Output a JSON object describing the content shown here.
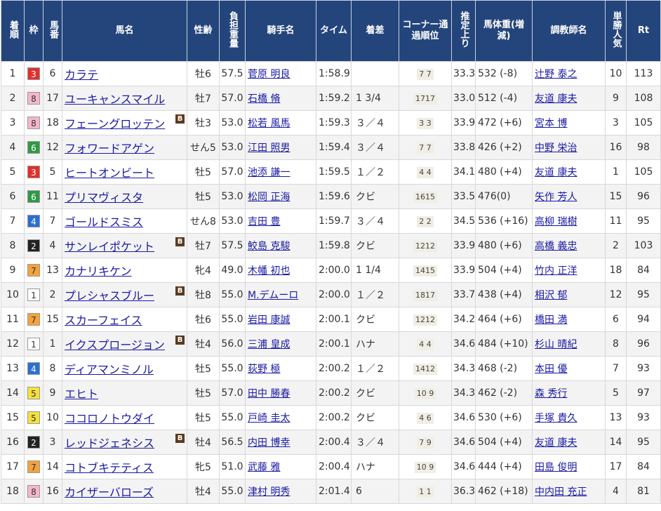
{
  "headers": {
    "rank": "着順",
    "waku": "枠",
    "umaban": "馬番",
    "horse": "馬名",
    "sexage": "性齢",
    "weight": "負担重量",
    "jockey": "騎手名",
    "time": "タイム",
    "margin": "着差",
    "corner": "コーナー通過順位",
    "last3f": "推定上り",
    "body": "馬体重(増減)",
    "trainer": "調教師名",
    "pop": "単勝人気",
    "rt": "Rt"
  },
  "blinker_label": "B",
  "waku_colors": {
    "1": {
      "bg": "#ffffff",
      "fg": "#333333"
    },
    "2": {
      "bg": "#222222",
      "fg": "#ffffff"
    },
    "3": {
      "bg": "#e0302b",
      "fg": "#ffffff"
    },
    "4": {
      "bg": "#2a6fd4",
      "fg": "#ffffff"
    },
    "5": {
      "bg": "#f6e13a",
      "fg": "#333333"
    },
    "6": {
      "bg": "#2f9a45",
      "fg": "#ffffff"
    },
    "7": {
      "bg": "#f4a23a",
      "fg": "#333333"
    },
    "8": {
      "bg": "#f7b6c8",
      "fg": "#333333"
    }
  },
  "rows": [
    {
      "rank": "1",
      "waku": "3",
      "umaban": "6",
      "horse": "カラテ",
      "blinker": false,
      "sexage": "牡6",
      "weight": "57.5",
      "jockey": "菅原 明良",
      "time": "1:58.9",
      "margin": "",
      "corner": "7 7",
      "last3f": "33.3",
      "body": "532 (-8)",
      "trainer": "辻野 泰之",
      "pop": "10",
      "rt": "113"
    },
    {
      "rank": "2",
      "waku": "8",
      "umaban": "17",
      "horse": "ユーキャンスマイル",
      "blinker": false,
      "sexage": "牡7",
      "weight": "57.0",
      "jockey": "石橋 脩",
      "time": "1:59.2",
      "margin": "1 3/4",
      "corner": "1717",
      "last3f": "33.0",
      "body": "512 (-4)",
      "trainer": "友道 康夫",
      "pop": "9",
      "rt": "108"
    },
    {
      "rank": "3",
      "waku": "8",
      "umaban": "18",
      "horse": "フェーングロッテン",
      "blinker": true,
      "sexage": "牡3",
      "weight": "53.0",
      "jockey": "松若 風馬",
      "time": "1:59.3",
      "margin": "３／４",
      "corner": "3 3",
      "last3f": "33.9",
      "body": "472 (+6)",
      "trainer": "宮本 博",
      "pop": "3",
      "rt": "105"
    },
    {
      "rank": "4",
      "waku": "6",
      "umaban": "12",
      "horse": "フォワードアゲン",
      "blinker": false,
      "sexage": "せん5",
      "weight": "53.0",
      "jockey": "江田 照男",
      "time": "1:59.4",
      "margin": "３／４",
      "corner": "7 7",
      "last3f": "33.8",
      "body": "426 (+2)",
      "trainer": "中野 栄治",
      "pop": "16",
      "rt": "98"
    },
    {
      "rank": "5",
      "waku": "3",
      "umaban": "5",
      "horse": "ヒートオンビート",
      "blinker": false,
      "sexage": "牡5",
      "weight": "57.0",
      "jockey": "池添 謙一",
      "time": "1:59.5",
      "margin": "１／２",
      "corner": "4 4",
      "last3f": "34.1",
      "body": "480 (+4)",
      "trainer": "友道 康夫",
      "pop": "1",
      "rt": "105"
    },
    {
      "rank": "6",
      "waku": "6",
      "umaban": "11",
      "horse": "プリマヴィスタ",
      "blinker": false,
      "sexage": "牡5",
      "weight": "53.0",
      "jockey": "松岡 正海",
      "time": "1:59.6",
      "margin": "クビ",
      "corner": "1615",
      "last3f": "33.5",
      "body": "476(0)",
      "trainer": "矢作 芳人",
      "pop": "15",
      "rt": "96"
    },
    {
      "rank": "7",
      "waku": "4",
      "umaban": "7",
      "horse": "ゴールドスミス",
      "blinker": false,
      "sexage": "せん8",
      "weight": "53.0",
      "jockey": "吉田 豊",
      "time": "1:59.7",
      "margin": "３／４",
      "corner": "2 2",
      "last3f": "34.5",
      "body": "536 (+16)",
      "trainer": "高柳 瑞樹",
      "pop": "11",
      "rt": "95"
    },
    {
      "rank": "8",
      "waku": "2",
      "umaban": "4",
      "horse": "サンレイポケット",
      "blinker": true,
      "sexage": "牡7",
      "weight": "57.5",
      "jockey": "鮫島 克駿",
      "time": "1:59.8",
      "margin": "クビ",
      "corner": "1212",
      "last3f": "33.9",
      "body": "480 (+6)",
      "trainer": "高橋 義忠",
      "pop": "2",
      "rt": "103"
    },
    {
      "rank": "9",
      "waku": "7",
      "umaban": "13",
      "horse": "カナリキケン",
      "blinker": false,
      "sexage": "牝4",
      "weight": "49.0",
      "jockey": "木幡 初也",
      "time": "2:00.0",
      "margin": "1 1/4",
      "corner": "1415",
      "last3f": "33.9",
      "body": "504 (+4)",
      "trainer": "竹内 正洋",
      "pop": "18",
      "rt": "84"
    },
    {
      "rank": "10",
      "waku": "1",
      "umaban": "2",
      "horse": "プレシャスブルー",
      "blinker": true,
      "sexage": "牡8",
      "weight": "55.0",
      "jockey": "M.デムーロ",
      "time": "2:00.0",
      "margin": "１／２",
      "corner": "1817",
      "last3f": "33.7",
      "body": "438 (+4)",
      "trainer": "相沢 郁",
      "pop": "12",
      "rt": "95"
    },
    {
      "rank": "11",
      "waku": "7",
      "umaban": "15",
      "horse": "スカーフェイス",
      "blinker": false,
      "sexage": "牡6",
      "weight": "55.0",
      "jockey": "岩田 康誠",
      "time": "2:00.1",
      "margin": "クビ",
      "corner": "1212",
      "last3f": "34.2",
      "body": "464 (+6)",
      "trainer": "橋田 満",
      "pop": "6",
      "rt": "94"
    },
    {
      "rank": "12",
      "waku": "1",
      "umaban": "1",
      "horse": "イクスプロージョン",
      "blinker": true,
      "sexage": "牡4",
      "weight": "56.0",
      "jockey": "三浦 皇成",
      "time": "2:00.1",
      "margin": "ハナ",
      "corner": "4 4",
      "last3f": "34.6",
      "body": "484 (+10)",
      "trainer": "杉山 晴紀",
      "pop": "8",
      "rt": "96"
    },
    {
      "rank": "13",
      "waku": "4",
      "umaban": "8",
      "horse": "ディアマンミノル",
      "blinker": false,
      "sexage": "牡5",
      "weight": "55.0",
      "jockey": "荻野 極",
      "time": "2:00.2",
      "margin": "１／２",
      "corner": "1412",
      "last3f": "34.3",
      "body": "468 (-2)",
      "trainer": "本田 優",
      "pop": "7",
      "rt": "93"
    },
    {
      "rank": "14",
      "waku": "5",
      "umaban": "9",
      "horse": "エヒト",
      "blinker": false,
      "sexage": "牡5",
      "weight": "57.0",
      "jockey": "田中 勝春",
      "time": "2:00.2",
      "margin": "クビ",
      "corner": "10 9",
      "last3f": "34.3",
      "body": "462 (-2)",
      "trainer": "森 秀行",
      "pop": "5",
      "rt": "97"
    },
    {
      "rank": "15",
      "waku": "5",
      "umaban": "10",
      "horse": "ココロノトウダイ",
      "blinker": false,
      "sexage": "牡5",
      "weight": "55.0",
      "jockey": "戸崎 圭太",
      "time": "2:00.2",
      "margin": "クビ",
      "corner": "4 6",
      "last3f": "34.6",
      "body": "530 (+6)",
      "trainer": "手塚 貴久",
      "pop": "13",
      "rt": "93"
    },
    {
      "rank": "16",
      "waku": "2",
      "umaban": "3",
      "horse": "レッドジェネシス",
      "blinker": true,
      "sexage": "牡4",
      "weight": "56.5",
      "jockey": "内田 博幸",
      "time": "2:00.4",
      "margin": "３／４",
      "corner": "7 9",
      "last3f": "34.6",
      "body": "504 (+4)",
      "trainer": "友道 康夫",
      "pop": "14",
      "rt": "95"
    },
    {
      "rank": "17",
      "waku": "7",
      "umaban": "14",
      "horse": "コトブキテティス",
      "blinker": false,
      "sexage": "牝5",
      "weight": "51.0",
      "jockey": "武藤 雅",
      "time": "2:00.4",
      "margin": "ハナ",
      "corner": "10 9",
      "last3f": "34.6",
      "body": "444 (+4)",
      "trainer": "田島 俊明",
      "pop": "17",
      "rt": "84"
    },
    {
      "rank": "18",
      "waku": "8",
      "umaban": "16",
      "horse": "カイザーバローズ",
      "blinker": false,
      "sexage": "牡4",
      "weight": "55.0",
      "jockey": "津村 明秀",
      "time": "2:01.4",
      "margin": "6",
      "corner": "1 1",
      "last3f": "36.3",
      "body": "462 (+18)",
      "trainer": "中内田 充正",
      "pop": "4",
      "rt": "81"
    }
  ]
}
